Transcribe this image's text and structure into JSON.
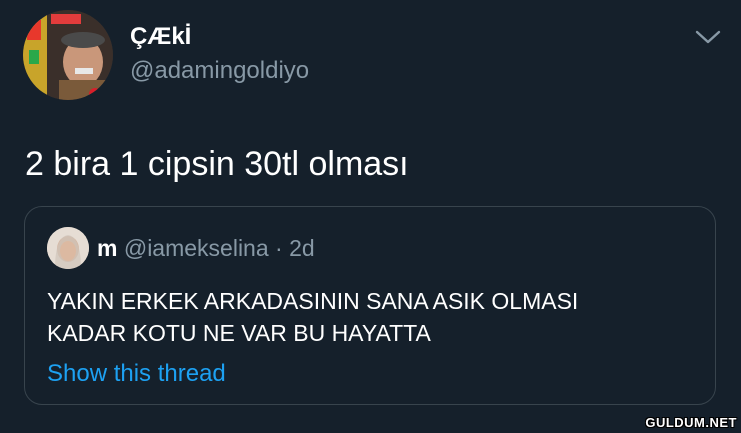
{
  "tweet": {
    "author": {
      "display_name": "ÇÆkİ",
      "handle": "@adamingoldiyo",
      "avatar_icon": "user-avatar-photo"
    },
    "menu_icon": "chevron-down-icon",
    "text": "2 bira 1 cipsin 30tl olması"
  },
  "quote": {
    "author": {
      "display_name": "m",
      "handle": "@iamekselina",
      "separator": "·",
      "time": "2d",
      "avatar_icon": "user-avatar-photo"
    },
    "text_lines": [
      "YAKIN ERKEK ARKADASININ SANA ASIK OLMASI",
      "KADAR KOTU NE VAR BU HAYATTA"
    ],
    "show_thread_label": "Show this thread"
  },
  "watermark": "GULDUM.NET",
  "colors": {
    "background": "#15202b",
    "text_primary": "#ffffff",
    "text_secondary": "#8899a6",
    "link": "#1da1f2",
    "border": "#38444d"
  }
}
